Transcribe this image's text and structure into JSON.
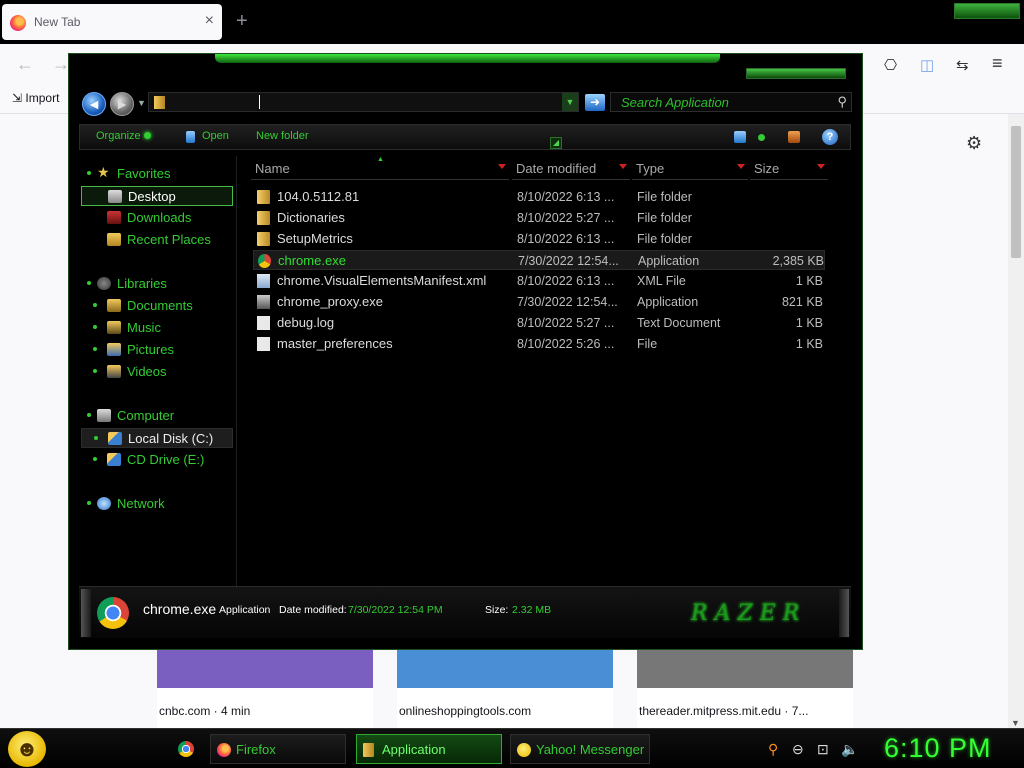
{
  "browser": {
    "tab_title": "New Tab",
    "tab_close": "×",
    "new_tab": "+",
    "back": "←",
    "forward": "→",
    "bookmark_import": "Import",
    "gear": "⚙",
    "icons": {
      "pocket": "⎔",
      "container": "◫",
      "extension": "⇆",
      "menu": "≡"
    }
  },
  "cards": [
    {
      "caption": "cnbc.com · 4 min",
      "color": "#7a5fc0"
    },
    {
      "caption": "onlineshoppingtools.com",
      "color": "#4a8fd6"
    },
    {
      "caption": "thereader.mitpress.mit.edu · 7...",
      "color": "#777777"
    }
  ],
  "explorer": {
    "address_value": "",
    "search_placeholder": "Search Application",
    "toolbar": {
      "organize": "Organize",
      "open": "Open",
      "new_folder": "New folder",
      "help": "?"
    },
    "nav": {
      "favorites": "Favorites",
      "desktop": "Desktop",
      "downloads": "Downloads",
      "recent_places": "Recent Places",
      "libraries": "Libraries",
      "documents": "Documents",
      "music": "Music",
      "pictures": "Pictures",
      "videos": "Videos",
      "computer": "Computer",
      "local_disk": "Local Disk (C:)",
      "cd_drive": "CD Drive (E:)",
      "network": "Network"
    },
    "columns": {
      "name": "Name",
      "date": "Date modified",
      "type": "Type",
      "size": "Size"
    },
    "files": [
      {
        "name": "104.0.5112.81",
        "date": "8/10/2022 6:13 ...",
        "type": "File folder",
        "size": "",
        "icon": "folder"
      },
      {
        "name": "Dictionaries",
        "date": "8/10/2022 5:27 ...",
        "type": "File folder",
        "size": "",
        "icon": "folder"
      },
      {
        "name": "SetupMetrics",
        "date": "8/10/2022 6:13 ...",
        "type": "File folder",
        "size": "",
        "icon": "folder"
      },
      {
        "name": "chrome.exe",
        "date": "7/30/2022 12:54...",
        "type": "Application",
        "size": "2,385 KB",
        "icon": "chrome"
      },
      {
        "name": "chrome.VisualElementsManifest.xml",
        "date": "8/10/2022 6:13 ...",
        "type": "XML File",
        "size": "1 KB",
        "icon": "xml"
      },
      {
        "name": "chrome_proxy.exe",
        "date": "7/30/2022 12:54...",
        "type": "Application",
        "size": "821 KB",
        "icon": "exe"
      },
      {
        "name": "debug.log",
        "date": "8/10/2022 5:27 ...",
        "type": "Text Document",
        "size": "1 KB",
        "icon": "doc"
      },
      {
        "name": "master_preferences",
        "date": "8/10/2022 5:26 ...",
        "type": "File",
        "size": "1 KB",
        "icon": "doc"
      }
    ],
    "details": {
      "name": "chrome.exe",
      "kind": "Application",
      "date_label": "Date modified:",
      "date_value": "7/30/2022 12:54 PM",
      "size_label": "Size:",
      "size_value": "2.32 MB",
      "logo": "RAZER"
    }
  },
  "taskbar": {
    "start_icon": "☻",
    "tasks": [
      "Firefox",
      "Application",
      "Yahoo! Messenger"
    ],
    "clock": "6:10 PM",
    "tray": {
      "search": "⚲",
      "minus": "⊖",
      "network": "⊡",
      "volume": "🔈"
    }
  }
}
